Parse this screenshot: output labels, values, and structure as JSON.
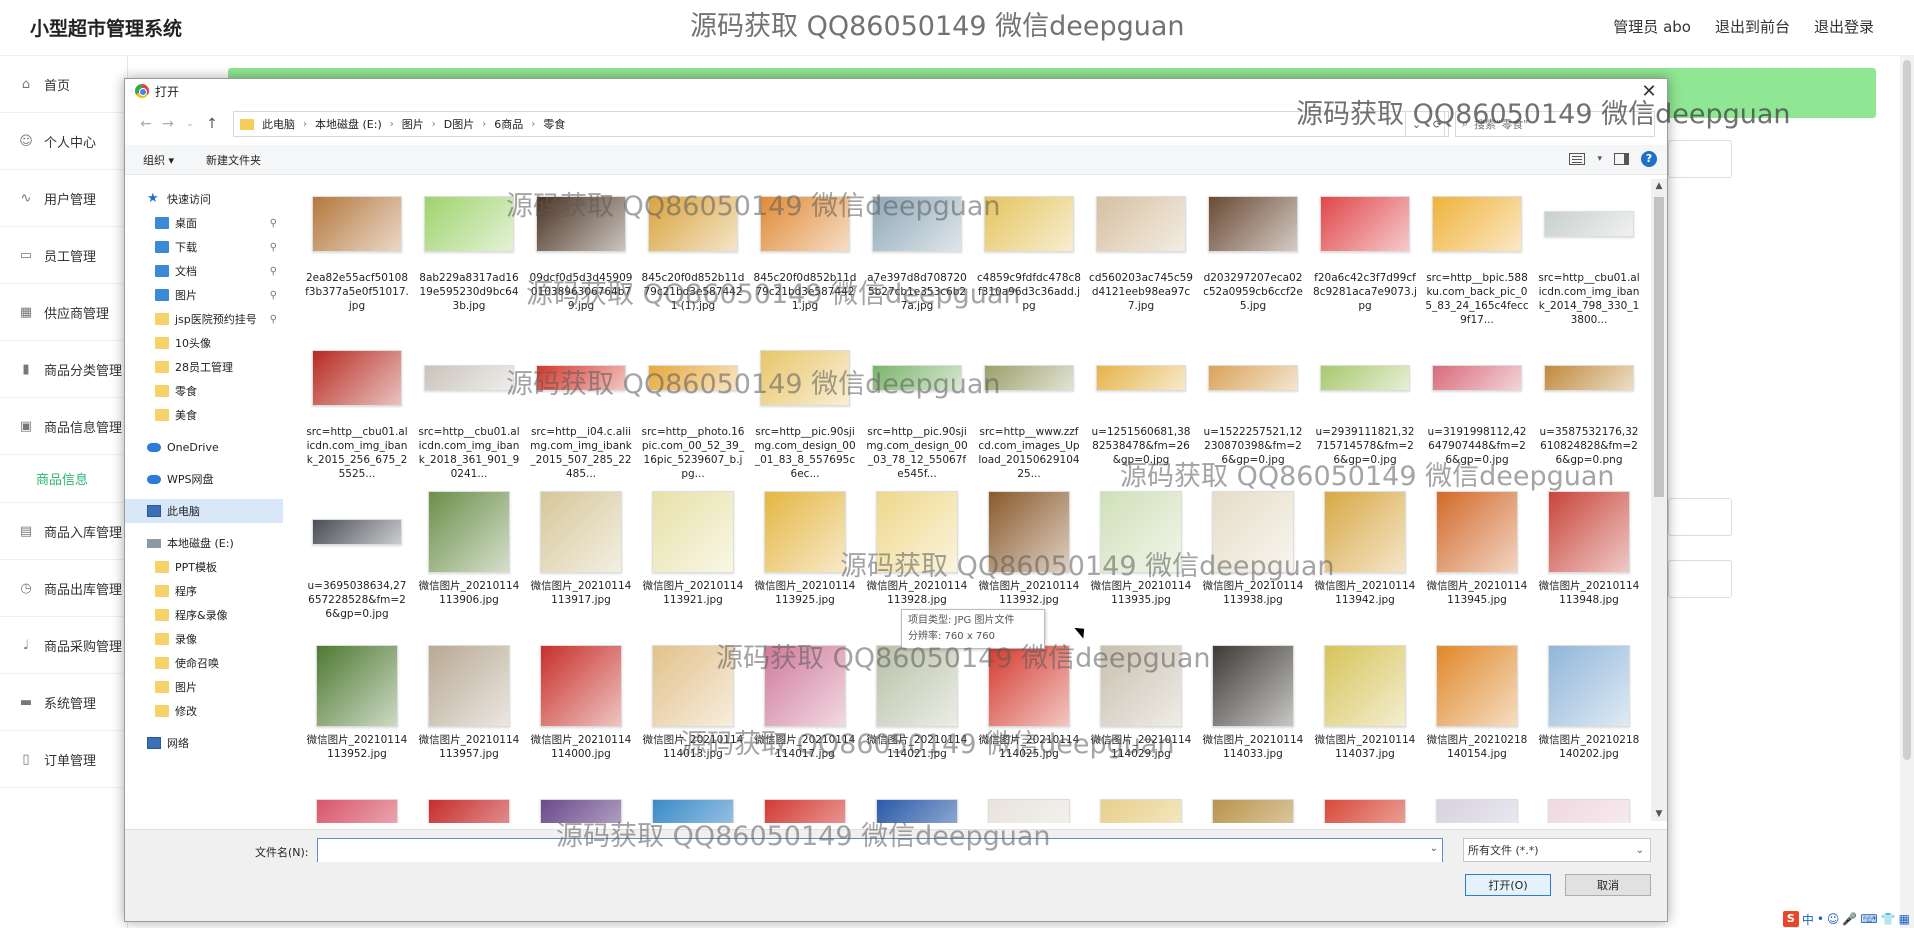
{
  "app": {
    "title": "小型超市管理系统",
    "admin": "管理员 abo",
    "back_front": "退出到前台",
    "logout": "退出登录"
  },
  "sidebar": {
    "items": [
      {
        "label": "首页",
        "icon": "home-icon"
      },
      {
        "label": "个人中心",
        "icon": "person-icon"
      },
      {
        "label": "用户管理",
        "icon": "chart-icon"
      },
      {
        "label": "员工管理",
        "icon": "badge-icon"
      },
      {
        "label": "供应商管理",
        "icon": "grid-icon"
      },
      {
        "label": "商品分类管理",
        "icon": "bar-chart-icon"
      },
      {
        "label": "商品信息管理",
        "icon": "trash-icon"
      },
      {
        "label": "商品信息",
        "icon": ""
      },
      {
        "label": "商品入库管理",
        "icon": "clipboard-icon"
      },
      {
        "label": "商品出库管理",
        "icon": "clock-icon"
      },
      {
        "label": "商品采购管理",
        "icon": "mic-icon"
      },
      {
        "label": "系统管理",
        "icon": "monitor-icon"
      },
      {
        "label": "订单管理",
        "icon": "phone-icon"
      }
    ]
  },
  "dialog": {
    "title": "打开",
    "breadcrumb": [
      "此电脑",
      "本地磁盘 (E:)",
      "图片",
      "D图片",
      "6商品",
      "零食"
    ],
    "search_placeholder": "搜索\"零食\"",
    "organize": "组织 ▾",
    "new_folder": "新建文件夹",
    "filename_label": "文件名(N):",
    "filename_value": "",
    "filetype": "所有文件 (*.*)",
    "open_button": "打开(O)",
    "cancel_button": "取消",
    "tooltip_type": "项目类型: JPG 图片文件",
    "tooltip_size": "分辨率: 760 x 760"
  },
  "tree": [
    {
      "label": "快速访问",
      "type": "star",
      "level": "top"
    },
    {
      "label": "桌面",
      "type": "blue",
      "pinned": true
    },
    {
      "label": "下载",
      "type": "blue",
      "pinned": true
    },
    {
      "label": "文档",
      "type": "blue",
      "pinned": true
    },
    {
      "label": "图片",
      "type": "blue",
      "pinned": true
    },
    {
      "label": "jsp医院预约挂号",
      "type": "folder",
      "pinned": true
    },
    {
      "label": "10头像",
      "type": "folder"
    },
    {
      "label": "28员工管理",
      "type": "folder"
    },
    {
      "label": "零食",
      "type": "folder"
    },
    {
      "label": "美食",
      "type": "folder"
    },
    {
      "label": "OneDrive",
      "type": "cloud",
      "level": "top"
    },
    {
      "label": "WPS网盘",
      "type": "cloud",
      "level": "top"
    },
    {
      "label": "此电脑",
      "type": "pc",
      "level": "top",
      "selected": true
    },
    {
      "label": "本地磁盘 (E:)",
      "type": "drive",
      "level": "top"
    },
    {
      "label": "PPT模板",
      "type": "folder"
    },
    {
      "label": "程序",
      "type": "folder"
    },
    {
      "label": "程序&录像",
      "type": "folder"
    },
    {
      "label": "录像",
      "type": "folder"
    },
    {
      "label": "使命召唤",
      "type": "folder"
    },
    {
      "label": "图片",
      "type": "folder"
    },
    {
      "label": "修改",
      "type": "folder"
    },
    {
      "label": "网络",
      "type": "net",
      "level": "top"
    }
  ],
  "files": [
    {
      "name": "2ea82e55acf50108f3b377a5e0f51017.jpg",
      "color": "#b5783e",
      "shape": "wide"
    },
    {
      "name": "8ab229a8317ad1619e595230d9bc643b.jpg",
      "color": "#9fd36c",
      "shape": "wide"
    },
    {
      "name": "09dcf0d5d3d459090103896306764b79.jpg",
      "color": "#4a3322",
      "shape": "wide"
    },
    {
      "name": "845c20f0d852b11d79c21bd3e5874421 (1).jpg",
      "color": "#d9a33d",
      "shape": "wide"
    },
    {
      "name": "845c20f0d852b11d79c21bd3e5874421.jpg",
      "color": "#e08a35",
      "shape": "wide"
    },
    {
      "name": "a7e397d8d7087205b27cb1e353c6b27a.jpg",
      "color": "#8fa8b8",
      "shape": "wide"
    },
    {
      "name": "c4859c9fdfdc478c8f310a96d3c36add.jpg",
      "color": "#e5c45e",
      "shape": "wide"
    },
    {
      "name": "cd560203ac745c59d4121eeb98ea97c7.jpg",
      "color": "#d6c0a0",
      "shape": "wide"
    },
    {
      "name": "d203297207eca02c52a0959cb6ccf2e5.jpg",
      "color": "#6a4a34",
      "shape": "wide"
    },
    {
      "name": "f20a6c42c3f7d99cf8c9281aca7e9073.jpg",
      "color": "#e0474a",
      "shape": "wide"
    },
    {
      "name": "src=http__bpic.588ku.com_back_pic_05_83_24_165c4fecc9f17...",
      "color": "#f0b23a",
      "shape": "wide"
    },
    {
      "name": "src=http__cbu01.alicdn.com_img_ibank_2014_798_330_13800...",
      "color": "#c8d0cc",
      "shape": "strip"
    },
    {
      "name": "src=http__cbu01.alicdn.com_img_ibank_2015_256_675_25525...",
      "color": "#b72b22",
      "shape": "wide"
    },
    {
      "name": "src=http__cbu01.alicdn.com_img_ibank_2018_361_901_90241...",
      "color": "#c9c3ba",
      "shape": "strip"
    },
    {
      "name": "src=http__i04.c.aliimg.com_img_ibank_2015_507_285_22485...",
      "color": "#d4382c",
      "shape": "strip"
    },
    {
      "name": "src=http__photo.16pic.com_00_52_39_16pic_5239607_b.jpg...",
      "color": "#e7a83c",
      "shape": "strip"
    },
    {
      "name": "src=http__pic.90sjimg.com_design_00_01_83_8_557695c6ec...",
      "color": "#e8c66a",
      "shape": "wide"
    },
    {
      "name": "src=http__pic.90sjimg.com_design_00_03_78_12_55067fe545f...",
      "color": "#7ab36a",
      "shape": "strip"
    },
    {
      "name": "src=http__www.zzfcd.com_images_Upload_2015062910425...",
      "color": "#9aa06a",
      "shape": "strip"
    },
    {
      "name": "u=1251560681,3882538478&fm=26&gp=0.jpg",
      "color": "#e6b34a",
      "shape": "strip"
    },
    {
      "name": "u=1522257521,12230870398&fm=26&gp=0.jpg",
      "color": "#d9a35a",
      "shape": "strip"
    },
    {
      "name": "u=2939111821,32715714578&fm=26&gp=0.jpg",
      "color": "#a8c86e",
      "shape": "strip"
    },
    {
      "name": "u=3191998112,42647907448&fm=26&gp=0.jpg",
      "color": "#d86a7a",
      "shape": "strip"
    },
    {
      "name": "u=3587532176,32610824828&fm=26&gp=0.png",
      "color": "#c08a3e",
      "shape": "strip"
    },
    {
      "name": "u=3695038634,27657228528&fm=26&gp=0.jpg",
      "color": "#4a4d56",
      "shape": "strip"
    },
    {
      "name": "微信图片_20210114113906.jpg",
      "color": "#6c8f4a",
      "shape": "square"
    },
    {
      "name": "微信图片_20210114113917.jpg",
      "color": "#d6c79a",
      "shape": "square"
    },
    {
      "name": "微信图片_20210114113921.jpg",
      "color": "#e8e1a8",
      "shape": "square"
    },
    {
      "name": "微信图片_20210114113925.jpg",
      "color": "#e4b642",
      "shape": "square"
    },
    {
      "name": "微信图片_20210114113928.jpg",
      "color": "#efd88a",
      "shape": "square"
    },
    {
      "name": "微信图片_20210114113932.jpg",
      "color": "#8a5a2c",
      "shape": "square"
    },
    {
      "name": "微信图片_20210114113935.jpg",
      "color": "#cfe0b8",
      "shape": "square"
    },
    {
      "name": "微信图片_20210114113938.jpg",
      "color": "#e6ddc8",
      "shape": "square"
    },
    {
      "name": "微信图片_20210114113942.jpg",
      "color": "#d8a845",
      "shape": "square"
    },
    {
      "name": "微信图片_20210114113945.jpg",
      "color": "#d26a2a",
      "shape": "square"
    },
    {
      "name": "微信图片_20210114113948.jpg",
      "color": "#c8453a",
      "shape": "square"
    },
    {
      "name": "微信图片_20210114113952.jpg",
      "color": "#4f7a32",
      "shape": "square"
    },
    {
      "name": "微信图片_20210114113957.jpg",
      "color": "#b8a994",
      "shape": "square"
    },
    {
      "name": "微信图片_20210114114000.jpg",
      "color": "#c7302a",
      "shape": "square"
    },
    {
      "name": "微信图片_20210114114013.jpg",
      "color": "#e2c28a",
      "shape": "square"
    },
    {
      "name": "微信图片_20210114114017.jpg",
      "color": "#d07a9a",
      "shape": "square"
    },
    {
      "name": "微信图片_20210114114021.jpg",
      "color": "#b9c0a8",
      "shape": "square"
    },
    {
      "name": "微信图片_20210114114025.jpg",
      "color": "#d43a2e",
      "shape": "square"
    },
    {
      "name": "微信图片_20210114114029.jpg",
      "color": "#c8bfae",
      "shape": "square"
    },
    {
      "name": "微信图片_20210114114033.jpg",
      "color": "#3e3a36",
      "shape": "square"
    },
    {
      "name": "微信图片_20210114114037.jpg",
      "color": "#d6c45a",
      "shape": "square"
    },
    {
      "name": "微信图片_20210218140154.jpg",
      "color": "#e0882a",
      "shape": "square"
    },
    {
      "name": "微信图片_20210218140202.jpg",
      "color": "#8fb6da",
      "shape": "square"
    },
    {
      "name": "",
      "color": "#d8566a",
      "shape": "square"
    },
    {
      "name": "",
      "color": "#c72c2c",
      "shape": "square"
    },
    {
      "name": "",
      "color": "#6a4a8a",
      "shape": "square"
    },
    {
      "name": "",
      "color": "#3a8ac8",
      "shape": "square"
    },
    {
      "name": "",
      "color": "#d33a33",
      "shape": "square"
    },
    {
      "name": "",
      "color": "#2a5aa8",
      "shape": "square"
    },
    {
      "name": "",
      "color": "#e8e4dc",
      "shape": "square"
    },
    {
      "name": "",
      "color": "#e8d08a",
      "shape": "square"
    },
    {
      "name": "",
      "color": "#b8944a",
      "shape": "square"
    },
    {
      "name": "",
      "color": "#d84a3a",
      "shape": "square"
    },
    {
      "name": "",
      "color": "#d6d2e0",
      "shape": "square"
    },
    {
      "name": "",
      "color": "#f0d8e0",
      "shape": "square"
    }
  ],
  "watermark": "源码获取 QQ86050149 微信deepguan",
  "tray": [
    "中",
    "•",
    "☺",
    "🎤",
    "⌨",
    "👕",
    "▦"
  ]
}
